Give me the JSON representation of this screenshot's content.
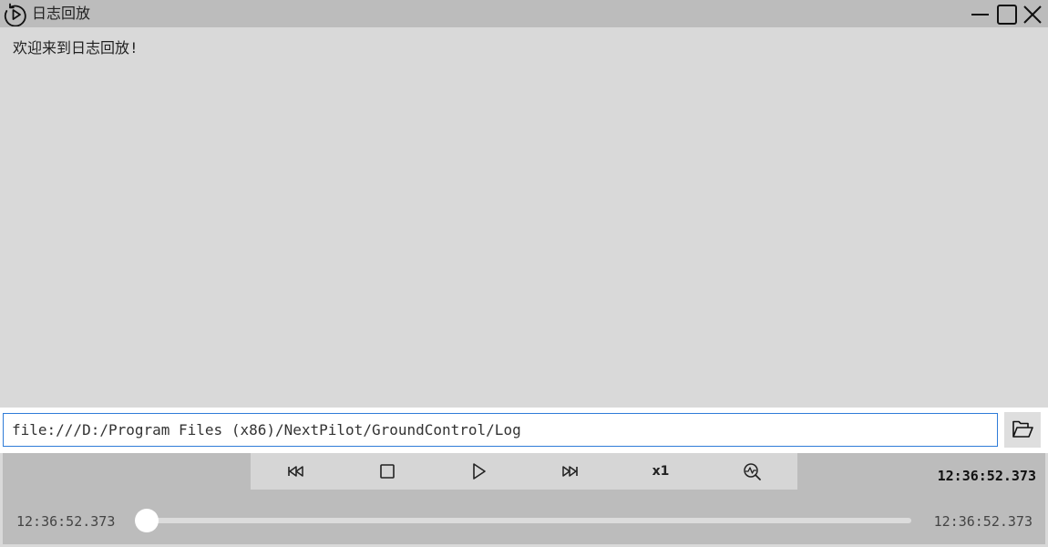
{
  "window": {
    "title": "日志回放",
    "app_icon": "replay-play-icon",
    "controls": [
      "minimize-icon",
      "maximize-icon",
      "close-icon"
    ]
  },
  "content": {
    "welcome_text": "欢迎来到日志回放!"
  },
  "path_bar": {
    "value": "file:///D:/Program Files (x86)/NextPilot/GroundControl/Log",
    "open_icon": "folder-open-icon"
  },
  "playback": {
    "buttons": [
      "skip-back-icon",
      "stop-icon",
      "play-icon",
      "skip-forward-icon",
      "speed",
      "chart-search-icon"
    ],
    "speed_label": "x1",
    "current_time": "12:36:52.373",
    "start_time": "12:36:52.373",
    "end_time": "12:36:52.373",
    "progress": 0
  },
  "colors": {
    "titlebar": "#bcbcbc",
    "background": "#d9d9d9",
    "input_border": "#2f7cd8"
  }
}
